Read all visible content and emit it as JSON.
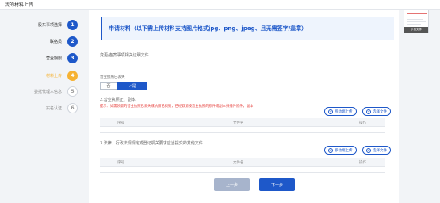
{
  "app": {
    "title": "我的材料上传"
  },
  "steps": [
    {
      "label": "股东事项选择",
      "num": "1",
      "state": "done"
    },
    {
      "label": "联络员",
      "num": "2",
      "state": "done"
    },
    {
      "label": "营业期限",
      "num": "3",
      "state": "done"
    },
    {
      "label": "材料上传",
      "num": "4",
      "state": "active"
    },
    {
      "label": "委托代理人信息",
      "num": "5",
      "state": "todo"
    },
    {
      "label": "实名认证",
      "num": "6",
      "state": "todo"
    }
  ],
  "banner": {
    "text": "申请材料（以下需上传材料支持图片格式jpg、png、jpeg、且无需签字/盖章）"
  },
  "section1": {
    "label": "变更/备案事项相关证明文件"
  },
  "question": {
    "label": "营业执照已丢失",
    "options": {
      "no": "否",
      "yes": "✓是"
    }
  },
  "section2": {
    "label": "2.营业执照正、副本",
    "warning": "提示：如需领取的营业执照已丢失或执照已损毁，已经取消按营业执照的原件或副本扫描件原件，副本",
    "buttons": {
      "mobile": "移动端上传",
      "select": "选择文件"
    },
    "columns": [
      "序号",
      "文件名",
      "操作"
    ]
  },
  "section3": {
    "label": "3.法律、行政法规规定或登记机关要求应当提交的其他文件",
    "buttons": {
      "mobile": "移动端上传",
      "select": "选择文件"
    },
    "columns": [
      "序号",
      "文件名",
      "操作"
    ]
  },
  "nav": {
    "prev": "上一步",
    "next": "下一步"
  },
  "thumbnail": {
    "caption": "示例文件"
  },
  "colors": {
    "primary": "#1e58c9",
    "active": "#f6b233",
    "warning": "#e53935"
  }
}
